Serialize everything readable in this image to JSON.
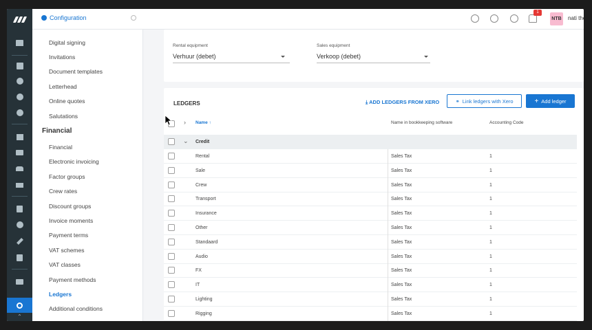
{
  "topbar": {
    "title": "Configuration",
    "notification_count": "1",
    "avatar_initials": "NTB",
    "username": "nati the b"
  },
  "sidebar": {
    "items": [
      {
        "label": "Digital signing"
      },
      {
        "label": "Invitations"
      },
      {
        "label": "Document templates"
      },
      {
        "label": "Letterhead"
      },
      {
        "label": "Online quotes"
      },
      {
        "label": "Salutations"
      }
    ],
    "section": "Financial",
    "financial_items": [
      {
        "label": "Financial"
      },
      {
        "label": "Electronic invoicing"
      },
      {
        "label": "Factor groups"
      },
      {
        "label": "Crew rates"
      },
      {
        "label": "Discount groups"
      },
      {
        "label": "Invoice moments"
      },
      {
        "label": "Payment terms"
      },
      {
        "label": "VAT schemes"
      },
      {
        "label": "VAT classes"
      },
      {
        "label": "Payment methods"
      },
      {
        "label": "Ledgers"
      },
      {
        "label": "Additional conditions"
      }
    ]
  },
  "equipment": {
    "rental_label": "Rental equipment",
    "rental_value": "Verhuur (debet)",
    "sales_label": "Sales equipment",
    "sales_value": "Verkoop (debet)"
  },
  "ledgers": {
    "title": "LEDGERS",
    "add_from_xero": "ADD LEDGERS FROM XERO",
    "link_xero": "Link ledgers with Xero",
    "add_ledger": "Add ledger",
    "columns": {
      "name": "Name",
      "bookkeeping": "Name in bookkeeping software",
      "code": "Accounting Code"
    },
    "group": "Credit",
    "rows": [
      {
        "name": "Rental",
        "bookkeeping": "Sales Tax",
        "code": "1"
      },
      {
        "name": "Sale",
        "bookkeeping": "Sales Tax",
        "code": "1"
      },
      {
        "name": "Crew",
        "bookkeeping": "Sales Tax",
        "code": "1"
      },
      {
        "name": "Transport",
        "bookkeeping": "Sales Tax",
        "code": "1"
      },
      {
        "name": "Insurance",
        "bookkeeping": "Sales Tax",
        "code": "1"
      },
      {
        "name": "Other",
        "bookkeeping": "Sales Tax",
        "code": "1"
      },
      {
        "name": "Standaard",
        "bookkeeping": "Sales Tax",
        "code": "1"
      },
      {
        "name": "Audio",
        "bookkeeping": "Sales Tax",
        "code": "1"
      },
      {
        "name": "FX",
        "bookkeeping": "Sales Tax",
        "code": "1"
      },
      {
        "name": "IT",
        "bookkeeping": "Sales Tax",
        "code": "1"
      },
      {
        "name": "Lighting",
        "bookkeeping": "Sales Tax",
        "code": "1"
      },
      {
        "name": "Rigging",
        "bookkeeping": "Sales Tax",
        "code": "1"
      }
    ]
  },
  "colors": {
    "accent": "#1976d2",
    "rail": "#263238"
  }
}
